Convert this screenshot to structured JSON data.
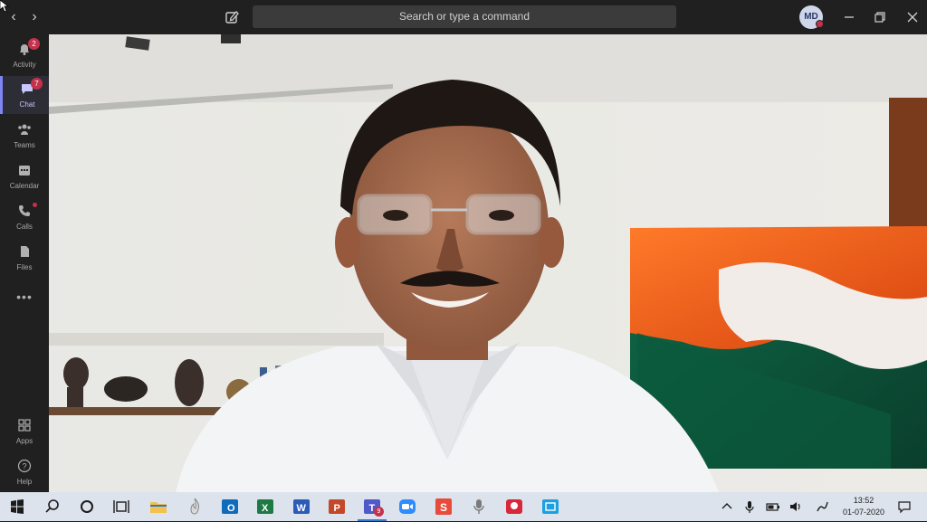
{
  "titlebar": {
    "search_placeholder": "Search or type a command",
    "avatar_initials": "MD",
    "presence_color": "#c4314b"
  },
  "rail": {
    "items": [
      {
        "label": "Activity",
        "icon": "bell-icon",
        "badge": "2"
      },
      {
        "label": "Chat",
        "icon": "chat-icon",
        "badge": "7",
        "active": true
      },
      {
        "label": "Teams",
        "icon": "teams-icon"
      },
      {
        "label": "Calendar",
        "icon": "calendar-icon"
      },
      {
        "label": "Calls",
        "icon": "phone-icon",
        "dot": true
      },
      {
        "label": "Files",
        "icon": "file-icon"
      }
    ],
    "more": "•••",
    "bottom": [
      {
        "label": "Apps",
        "icon": "apps-icon"
      },
      {
        "label": "Help",
        "icon": "help-icon"
      }
    ]
  },
  "taskbar": {
    "apps": [
      "windows-start",
      "search",
      "cortana",
      "task-view",
      "file-explorer",
      "chrome",
      "outlook",
      "excel",
      "word",
      "powerpoint",
      "teams",
      "zoom",
      "app-s",
      "microphone-app",
      "app-red",
      "app-blue"
    ],
    "teams_badge": "9",
    "time": "13:52",
    "date": "01-07-2020"
  },
  "colors": {
    "accent": "#7f85f5",
    "badge": "#c4314b"
  }
}
